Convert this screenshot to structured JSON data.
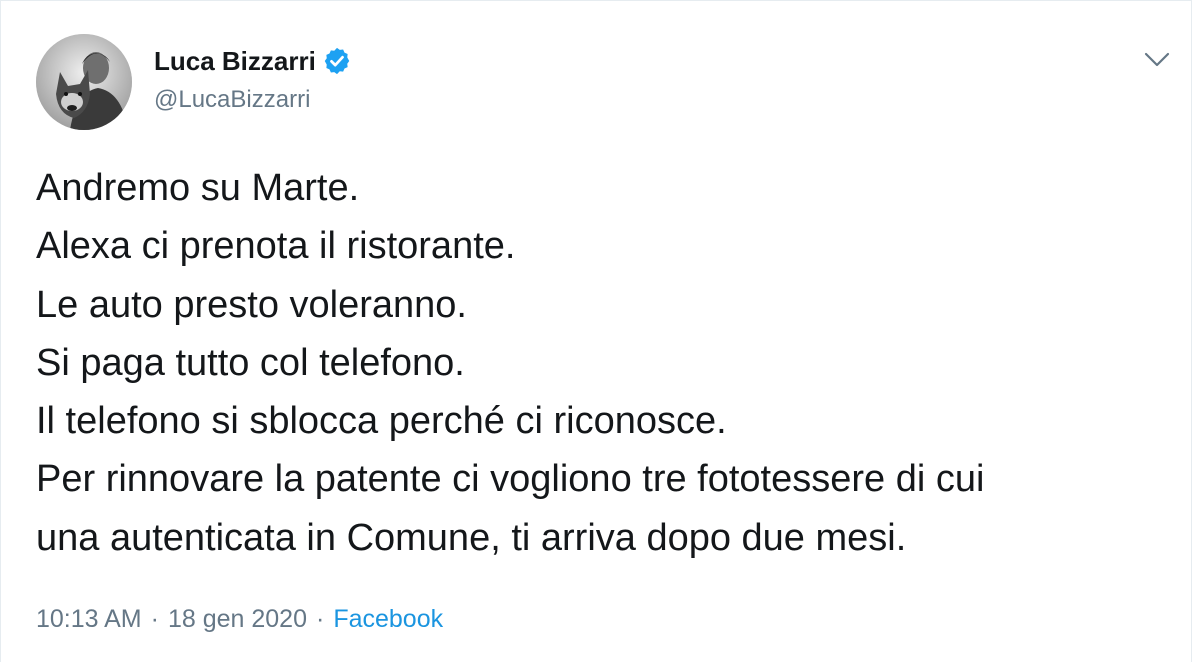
{
  "tweet": {
    "author": {
      "display_name": "Luca Bizzarri",
      "handle": "@LucaBizzarri",
      "verified": true,
      "avatar": "avatar-photo-with-dog"
    },
    "lines": [
      "Andremo su Marte.",
      "Alexa ci prenota il ristorante.",
      "Le auto presto voleranno.",
      "Si paga tutto col telefono.",
      "Il telefono si sblocca perché ci riconosce.",
      "Per rinnovare la patente ci vogliono tre fototessere di cui",
      "una autenticata in Comune, ti arriva dopo due mesi."
    ],
    "time": "10:13 AM",
    "separator": "·",
    "date": "18 gen 2020",
    "source": "Facebook"
  },
  "icons": {
    "verified": "verified-badge-icon",
    "menu": "chevron-down-icon"
  },
  "colors": {
    "text": "#14171a",
    "secondary": "#657786",
    "link": "#1b95e0",
    "verified": "#1da1f2",
    "border": "#e6ecf0"
  }
}
